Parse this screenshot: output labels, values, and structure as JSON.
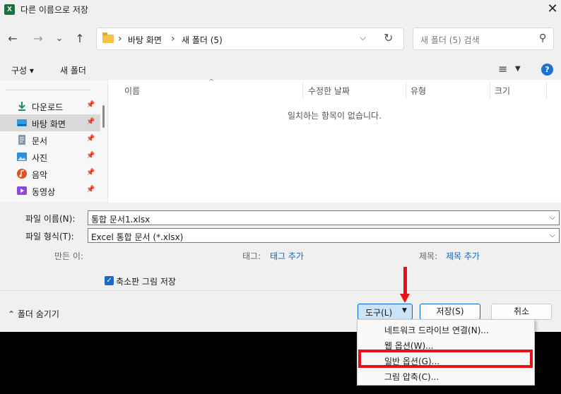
{
  "window": {
    "title": "다른 이름으로 저장",
    "app_icon_letter": "X",
    "close_glyph": "✕"
  },
  "nav": {
    "back_glyph": "←",
    "forward_glyph": "→",
    "recent_glyph": "⌄",
    "up_glyph": "↑",
    "breadcrumb": [
      "바탕 화면",
      "새 폴더 (5)"
    ],
    "breadcrumb_separator": "›",
    "address_dropdown_glyph": "⌵",
    "refresh_glyph": "↻",
    "search_placeholder": "새 폴더 (5) 검색",
    "search_glyph": "⚲"
  },
  "toolbar": {
    "organize_label": "구성 ▾",
    "new_folder_label": "새 폴더",
    "view_glyph": "≡",
    "view_dropdown_glyph": "▼",
    "help_glyph": "?"
  },
  "sidebar": {
    "pin_glyph": "📌",
    "items": [
      {
        "label": "다운로드",
        "icon": "download-icon",
        "color": "#1f8a70"
      },
      {
        "label": "바탕 화면",
        "icon": "desktop-icon",
        "color": "#2a9be0"
      },
      {
        "label": "문서",
        "icon": "document-icon",
        "color": "#6a7a8c"
      },
      {
        "label": "사진",
        "icon": "pictures-icon",
        "color": "#2b8fdc"
      },
      {
        "label": "음악",
        "icon": "music-icon",
        "color": "#e1541e"
      },
      {
        "label": "동영상",
        "icon": "video-icon",
        "color": "#8d4ad6"
      }
    ]
  },
  "filelist": {
    "sort_glyph": "^",
    "columns": [
      "이름",
      "수정한 날짜",
      "유형",
      "크기"
    ],
    "empty_message": "일치하는 항목이 없습니다."
  },
  "form": {
    "filename_label": "파일 이름(N):",
    "filename_value": "통합 문서1.xlsx",
    "filetype_label": "파일 형식(T):",
    "filetype_value": "Excel 통합 문서 (*.xlsx)",
    "dropdown_glyph": "⌵",
    "author_label": "만든 이:",
    "tags_label": "태그:",
    "tags_link": "태그 추가",
    "title_label": "제목:",
    "title_link": "제목 추가",
    "thumbnail_checkbox_label": "축소판 그림 저장",
    "thumbnail_checked": true,
    "check_glyph": "✓"
  },
  "footer": {
    "hide_folders_label": "⌃ 폴더 숨기기",
    "tools_label": "도구(L)",
    "tools_caret": "▼",
    "save_label": "저장(S)",
    "cancel_label": "취소"
  },
  "tools_menu": {
    "items": [
      "네트워크 드라이브 연결(N)...",
      "웹 옵션(W)...",
      "일반 옵션(G)...",
      "그림 압축(C)..."
    ],
    "highlighted": "일반 옵션(G)..."
  },
  "annotation": {
    "color": "#e8101a"
  }
}
